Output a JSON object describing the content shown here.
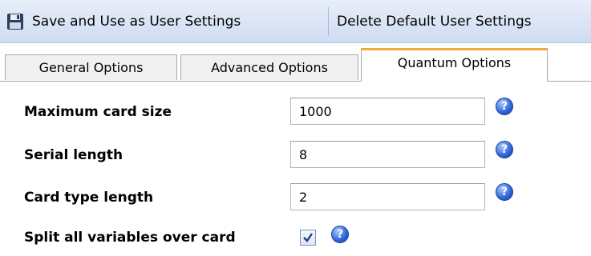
{
  "toolbar": {
    "save_label": "Save and Use as User Settings",
    "delete_label": "Delete Default User Settings",
    "save_icon": "floppy-disk-icon"
  },
  "tabs": [
    {
      "label": "General Options",
      "active": false
    },
    {
      "label": "Advanced Options",
      "active": false
    },
    {
      "label": "Quantum Options",
      "active": true
    }
  ],
  "form": {
    "max_card_size": {
      "label": "Maximum card size",
      "value": "1000"
    },
    "serial_length": {
      "label": "Serial length",
      "value": "8"
    },
    "card_type_length": {
      "label": "Card type length",
      "value": "2"
    },
    "split_vars": {
      "label": "Split all variables over card",
      "checked": true
    }
  },
  "help_icon": "help-question-icon",
  "help_glyph": "?",
  "colors": {
    "active_tab_accent": "#f2a93b",
    "toolbar_bg": "#dbe4f5",
    "help_blue": "#2d62d8"
  }
}
